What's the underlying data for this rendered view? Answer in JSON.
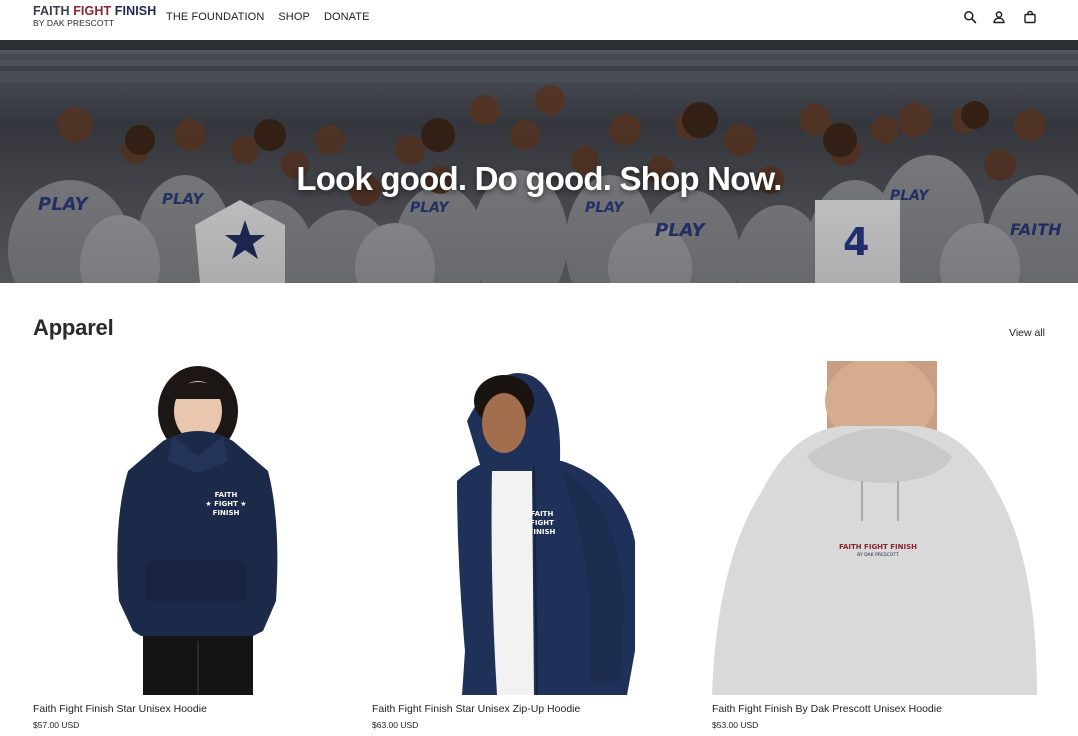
{
  "header": {
    "logo": {
      "line1_faith": "FAITH",
      "line1_fight": "FIGHT",
      "line1_finish": "FINISH",
      "line2": "BY DAK PRESCOTT"
    },
    "nav": [
      {
        "label": "THE FOUNDATION"
      },
      {
        "label": "SHOP"
      },
      {
        "label": "DONATE"
      }
    ],
    "icons": [
      "search-icon",
      "account-icon",
      "cart-icon"
    ]
  },
  "hero": {
    "title": "Look good. Do good. Shop Now."
  },
  "collection": {
    "title": "Apparel",
    "view_all": "View all",
    "products": [
      {
        "name": "Faith Fight Finish Star Unisex Hoodie",
        "price": "$57.00 USD",
        "chest_text": "FAITH\n★ FIGHT ★\nFINISH"
      },
      {
        "name": "Faith Fight Finish Star Unisex Zip-Up Hoodie",
        "price": "$63.00 USD",
        "chest_text": "FAITH\nFIGHT\nFINISH"
      },
      {
        "name": "Faith Fight Finish By Dak Prescott Unisex Hoodie",
        "price": "$53.00 USD",
        "chest_text": "FAITH FIGHT FINISH"
      }
    ]
  },
  "colors": {
    "navy": "#1c2a4a",
    "heather_gray": "#d9d9d9",
    "brand_red": "#8a2430",
    "brand_navy": "#232a55"
  }
}
